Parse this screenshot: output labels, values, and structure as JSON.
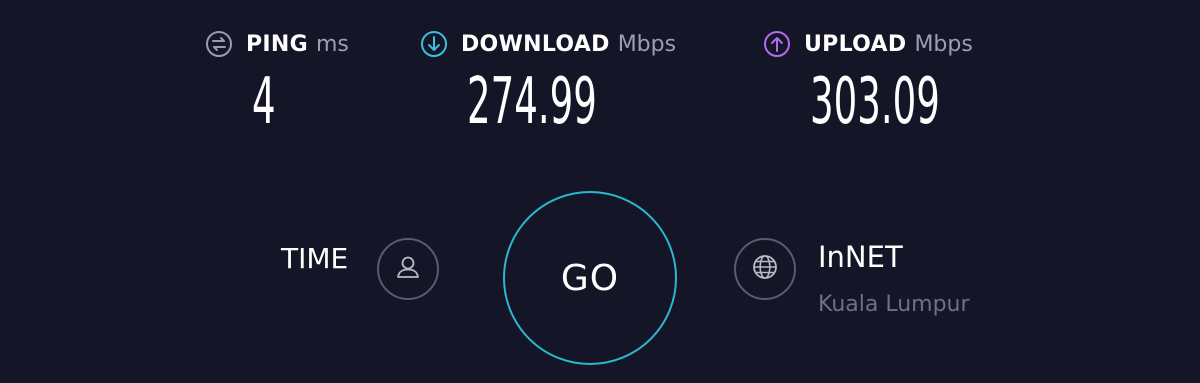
{
  "metrics": {
    "ping": {
      "label": "PING",
      "unit": "ms",
      "value": "4",
      "icon": "ping-icon",
      "color": "#9a9bae"
    },
    "download": {
      "label": "DOWNLOAD",
      "unit": "Mbps",
      "value": "274.99",
      "icon": "download-arrow-icon",
      "color": "#3ac0d8"
    },
    "upload": {
      "label": "UPLOAD",
      "unit": "Mbps",
      "value": "303.09",
      "icon": "upload-arrow-icon",
      "color": "#b36bef"
    }
  },
  "time_label": "TIME",
  "go_label": "GO",
  "provider": {
    "name": "InNET",
    "location": "Kuala Lumpur"
  },
  "colors": {
    "background": "#141526",
    "accent": "#2bb7cf",
    "muted": "#6e7083"
  }
}
